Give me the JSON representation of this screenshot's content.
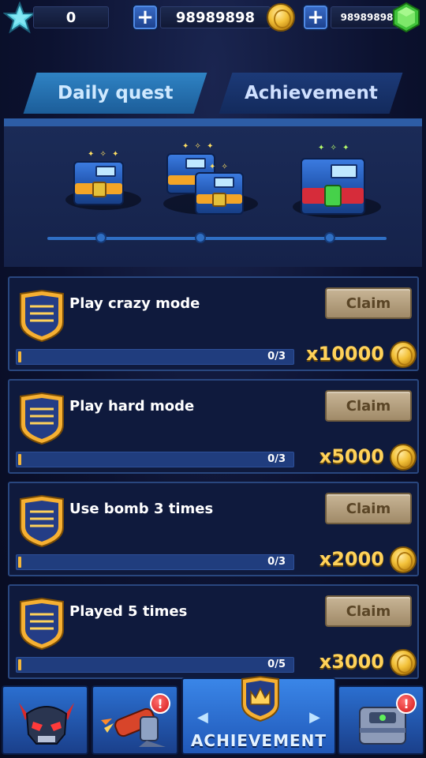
{
  "currency": {
    "stars": "0",
    "coins": "98989898",
    "gems": "98989898"
  },
  "tabs": [
    {
      "label": "Daily quest",
      "active": true
    },
    {
      "label": "Achievement",
      "active": false
    }
  ],
  "quests": [
    {
      "title": "Play crazy mode",
      "claim_label": "Claim",
      "progress": "0/3",
      "reward": "x10000"
    },
    {
      "title": "Play hard mode",
      "claim_label": "Claim",
      "progress": "0/3",
      "reward": "x5000"
    },
    {
      "title": "Use bomb 3 times",
      "claim_label": "Claim",
      "progress": "0/3",
      "reward": "x2000"
    },
    {
      "title": "Played 5 times",
      "claim_label": "Claim",
      "progress": "0/5",
      "reward": "x3000"
    }
  ],
  "nav": {
    "active_label": "ACHIEVEMENT",
    "badge": "!"
  },
  "colors": {
    "accent": "#2f83c4",
    "gold": "#ffd25a",
    "claim": "#b9a47f"
  }
}
